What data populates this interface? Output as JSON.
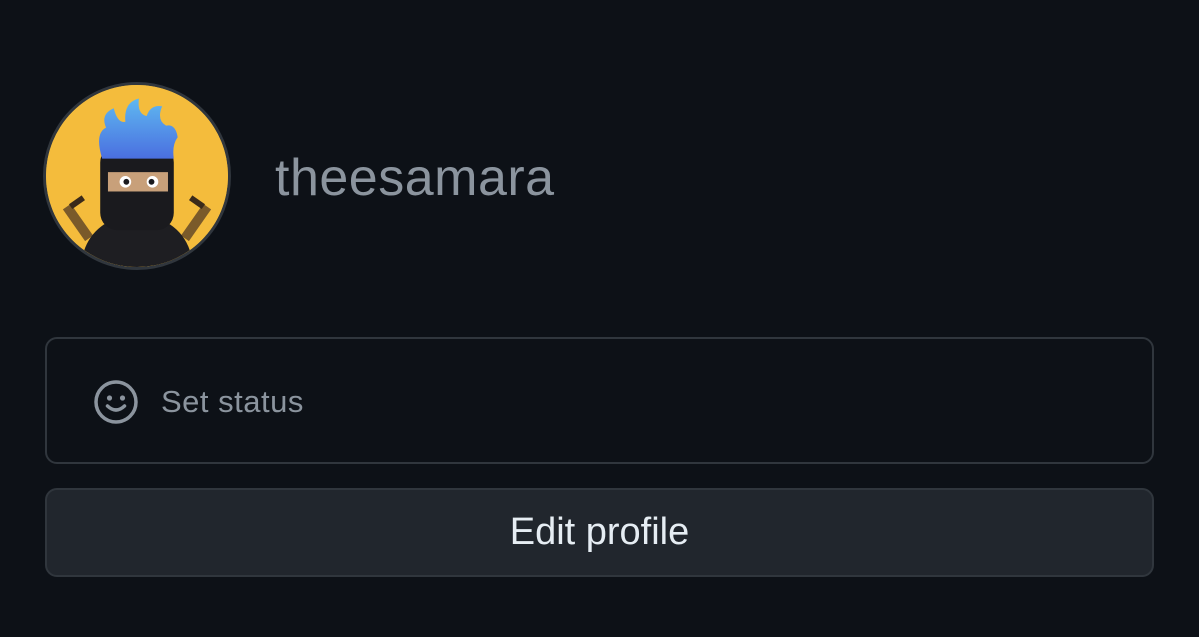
{
  "profile": {
    "username": "theesamara",
    "avatar_icon": "ninja-avatar"
  },
  "status": {
    "label": "Set status",
    "icon": "smiley-icon"
  },
  "actions": {
    "edit_profile_label": "Edit profile"
  },
  "colors": {
    "background": "#0d1117",
    "border": "#30363d",
    "muted_text": "#8b949e",
    "button_bg": "#21262d",
    "button_text": "#e6edf3",
    "avatar_bg": "#f4bc3c"
  }
}
